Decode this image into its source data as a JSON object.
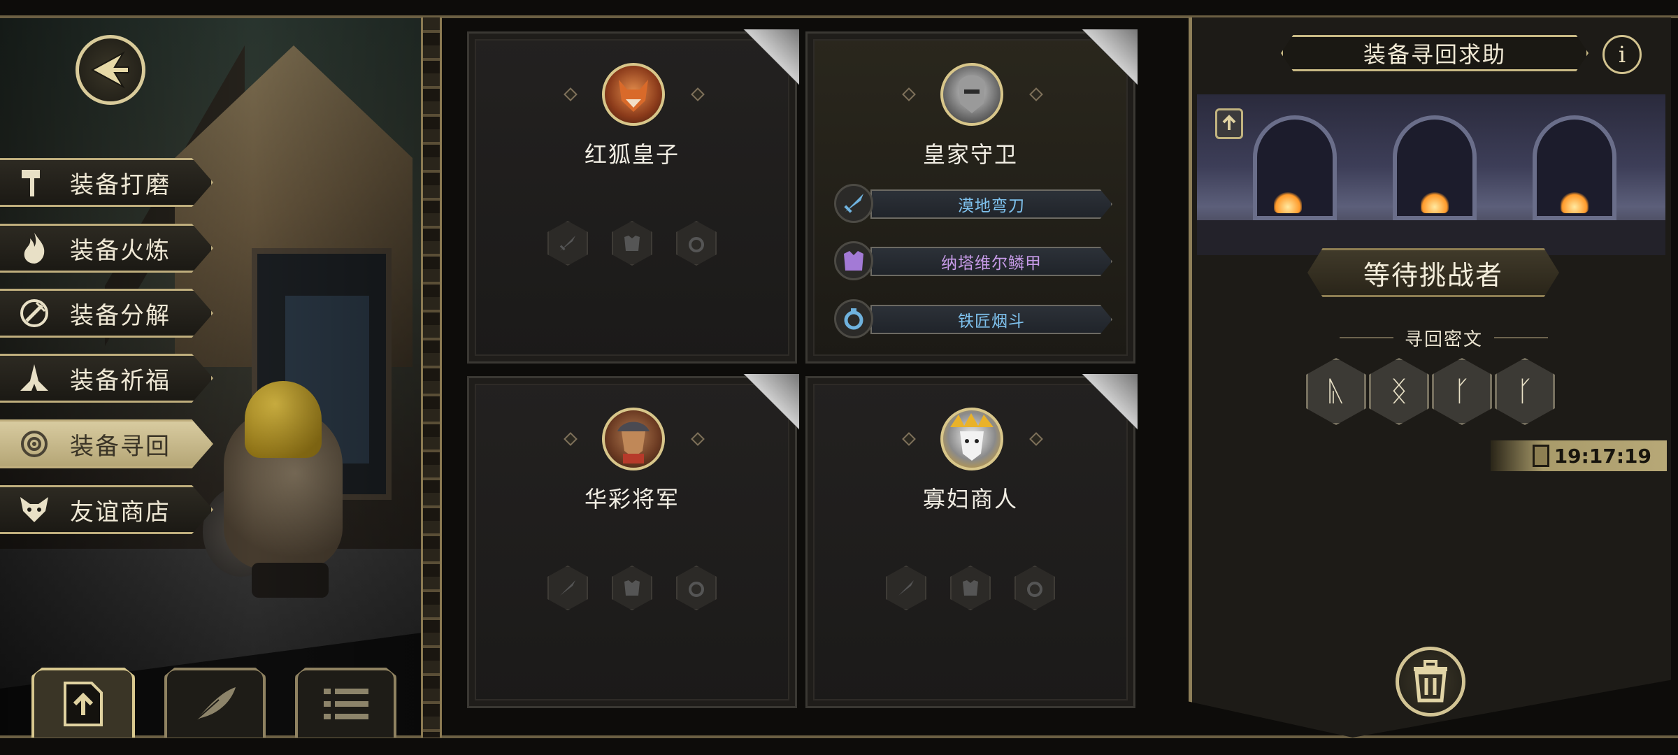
{
  "menu": {
    "items": [
      {
        "label": "装备打磨",
        "icon": "hammer-icon"
      },
      {
        "label": "装备火炼",
        "icon": "flame-icon"
      },
      {
        "label": "装备分解",
        "icon": "disassemble-icon"
      },
      {
        "label": "装备祈福",
        "icon": "pray-icon"
      },
      {
        "label": "装备寻回",
        "icon": "target-icon",
        "active": true
      },
      {
        "label": "友谊商店",
        "icon": "fox-icon"
      }
    ]
  },
  "bottom_buttons": [
    {
      "icon": "share-upload-icon",
      "active": true
    },
    {
      "icon": "feather-icon"
    },
    {
      "icon": "list-icon"
    }
  ],
  "cards": [
    {
      "name": "红狐皇子",
      "portrait": "red-fox-portrait",
      "equipped": []
    },
    {
      "name": "皇家守卫",
      "portrait": "royal-guard-portrait",
      "equipped": [
        {
          "label": "漠地弯刀",
          "icon": "sword-icon",
          "color": "#7fc2ee"
        },
        {
          "label": "纳塔维尔鳞甲",
          "icon": "armor-icon",
          "color": "#c79be8"
        },
        {
          "label": "铁匠烟斗",
          "icon": "ring-icon",
          "color": "#7fc2ee"
        }
      ]
    },
    {
      "name": "华彩将军",
      "portrait": "general-portrait",
      "equipped": []
    },
    {
      "name": "寡妇商人",
      "portrait": "widow-merchant-portrait",
      "equipped": []
    }
  ],
  "panel": {
    "title": "装备寻回求助",
    "info_glyph": "i",
    "status": "等待挑战者",
    "cipher_title": "寻回密文",
    "runes": [
      "ᚣ",
      "ᛝ",
      "ᚴ",
      "ᚴ"
    ],
    "timer": "19:17:19"
  },
  "colors": {
    "gold": "#d8c88e",
    "bg": "#0d0c0a"
  }
}
